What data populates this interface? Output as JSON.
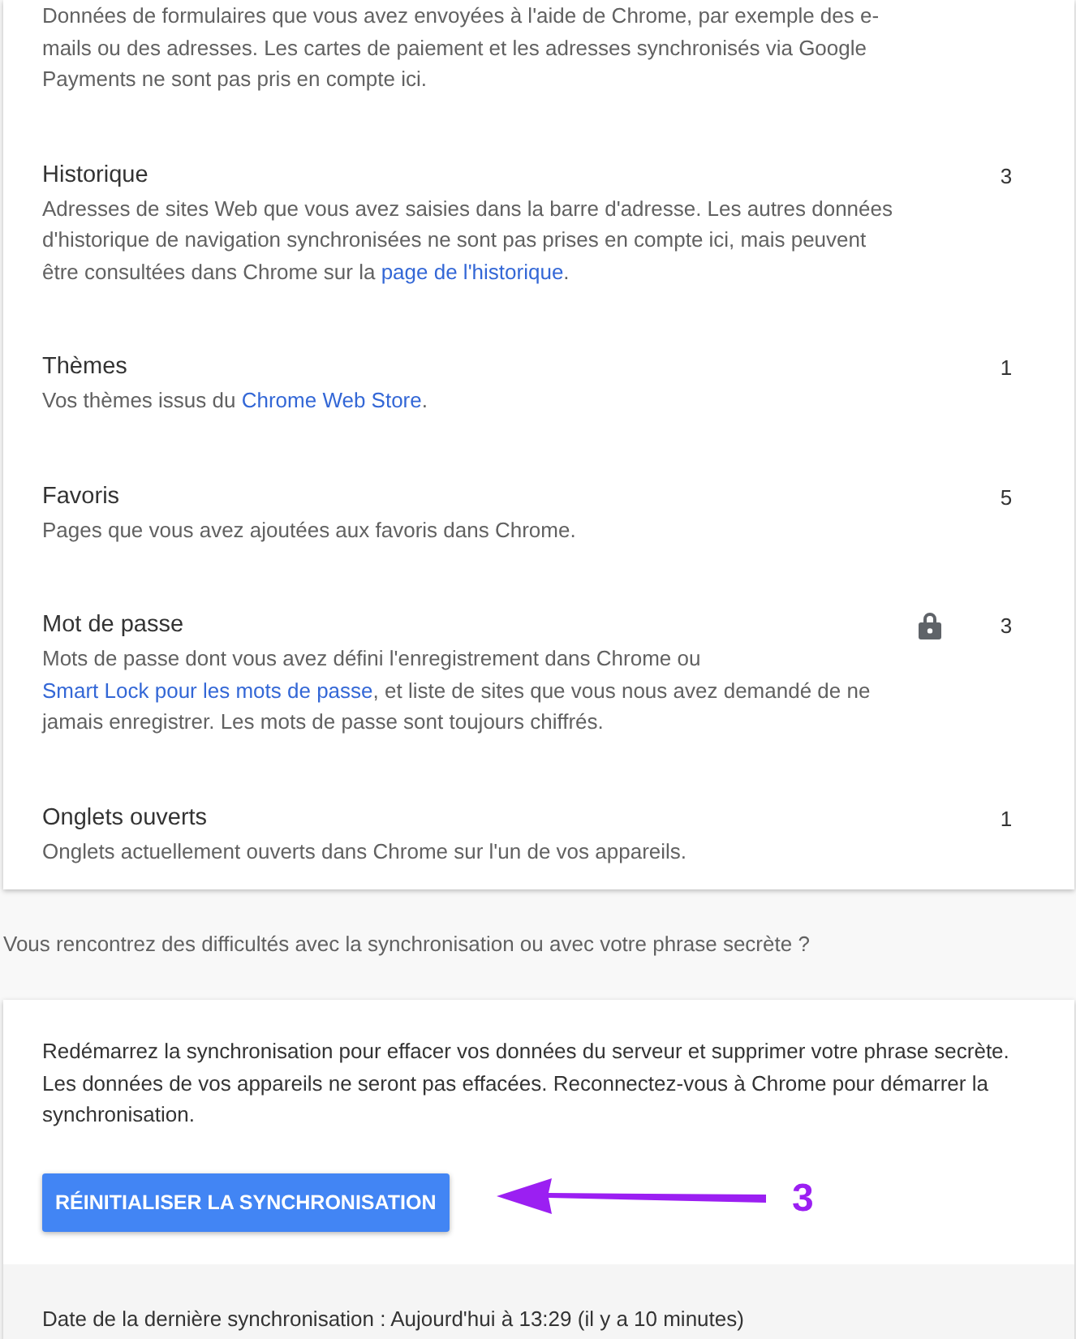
{
  "sync_items": [
    {
      "description": [
        {
          "kind": "text",
          "text": "Données de formulaires que vous avez envoyées à l'aide de Chrome, par exemple des e-mails ou des adresses. Les cartes de paiement et les adresses synchronisés via Google Payments ne sont pas pris en compte ici."
        }
      ]
    },
    {
      "title": "Historique",
      "count": "3",
      "description": [
        {
          "kind": "text",
          "text": "Adresses de sites Web que vous avez saisies dans la barre d'adresse. Les autres données d'historique de navigation synchronisées ne sont pas prises en compte ici, mais peuvent être consultées dans Chrome sur la "
        },
        {
          "kind": "link",
          "text": "page de l'historique"
        },
        {
          "kind": "text",
          "text": "."
        }
      ]
    },
    {
      "title": "Thèmes",
      "count": "1",
      "description": [
        {
          "kind": "text",
          "text": "Vos thèmes issus du "
        },
        {
          "kind": "link",
          "text": "Chrome Web Store"
        },
        {
          "kind": "text",
          "text": "."
        }
      ]
    },
    {
      "title": "Favoris",
      "count": "5",
      "description": [
        {
          "kind": "text",
          "text": "Pages que vous avez ajoutées aux favoris dans Chrome."
        }
      ]
    },
    {
      "title": "Mot de passe",
      "count": "3",
      "locked": true,
      "description": [
        {
          "kind": "text",
          "text": "Mots de passe dont vous avez défini l'enregistrement dans Chrome ou "
        },
        {
          "kind": "link",
          "text": "Smart Lock pour les mots de passe"
        },
        {
          "kind": "text",
          "text": ", et liste de sites que vous nous avez demandé de ne jamais enregistrer. Les mots de passe sont toujours chiffrés."
        }
      ]
    },
    {
      "title": "Onglets ouverts",
      "count": "1",
      "description": [
        {
          "kind": "text",
          "text": "Onglets actuellement ouverts dans Chrome sur l'un de vos appareils."
        }
      ]
    }
  ],
  "help_text": "Vous rencontrez des difficultés avec la synchronisation ou avec votre phrase secrète ?",
  "reset": {
    "description": "Redémarrez la synchronisation pour effacer vos données du serveur et supprimer votre phrase secrète. Les données de vos appareils ne seront pas effacées. Reconnectez-vous à Chrome pour démarrer la synchronisation.",
    "button": "RÉINITIALISER LA SYNCHRONISATION",
    "annotation": "3"
  },
  "last_sync": "Date de la dernière synchronisation : Aujourd'hui à 13:29 (il y a 10 minutes)"
}
